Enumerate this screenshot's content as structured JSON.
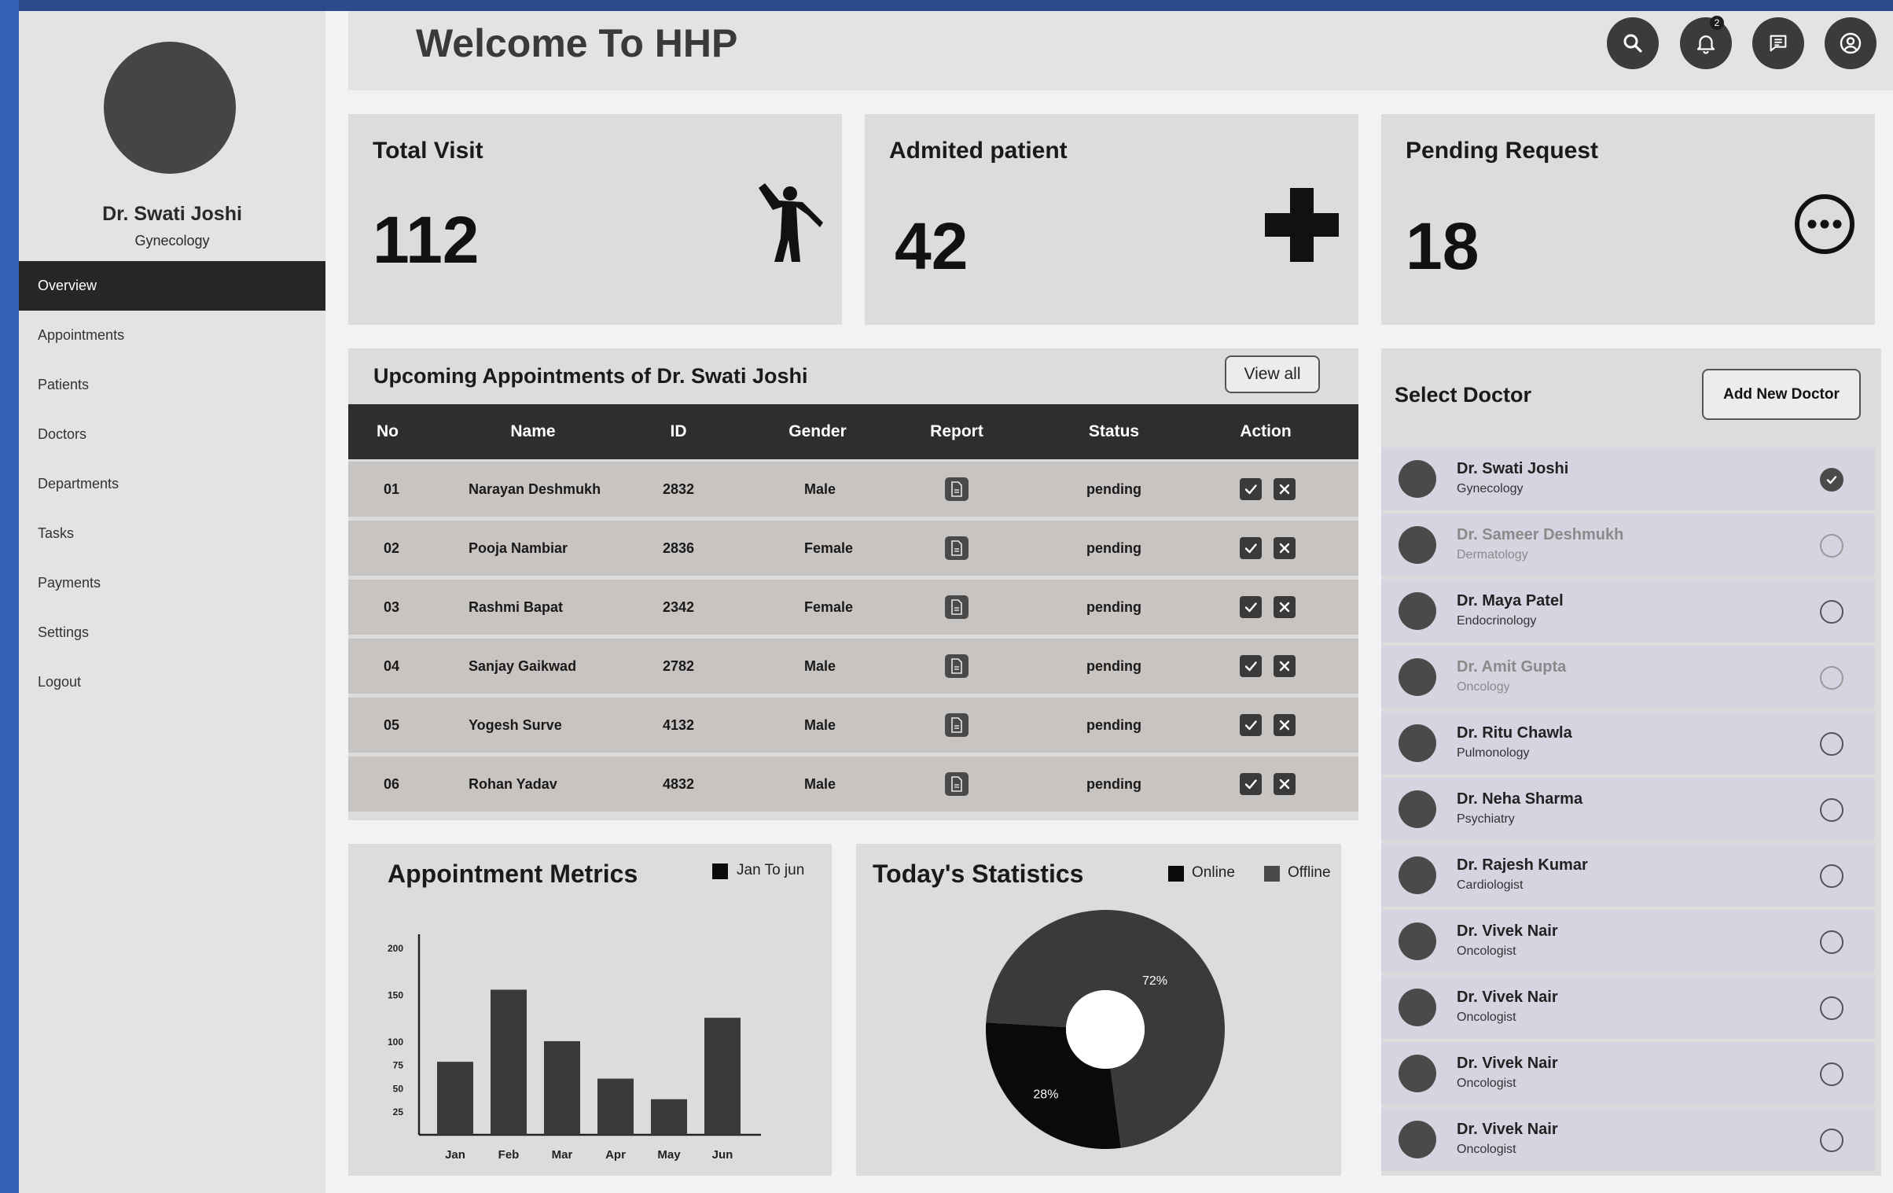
{
  "sidebar": {
    "doctor_name": "Dr. Swati Joshi",
    "doctor_specialty": "Gynecology",
    "items": [
      {
        "label": "Overview"
      },
      {
        "label": "Appointments"
      },
      {
        "label": "Patients"
      },
      {
        "label": "Doctors"
      },
      {
        "label": "Departments"
      },
      {
        "label": "Tasks"
      },
      {
        "label": "Payments"
      },
      {
        "label": "Settings"
      },
      {
        "label": "Logout"
      }
    ],
    "active_item": "Overview"
  },
  "header": {
    "title": "Welcome To HHP",
    "notification_count": "2",
    "icons": [
      "search-icon",
      "bell-icon",
      "chat-icon",
      "user-icon"
    ]
  },
  "stats": {
    "total_visit": {
      "title": "Total Visit",
      "value": "112",
      "icon": "walking-person-icon"
    },
    "admitted": {
      "title": "Admited patient",
      "value": "42",
      "icon": "plus-cross-icon"
    },
    "pending": {
      "title": "Pending Request",
      "value": "18",
      "icon": "more-circle-icon"
    }
  },
  "appointments": {
    "title": "Upcoming  Appointments of Dr. Swati Joshi",
    "view_all_label": "View all",
    "columns": [
      "No",
      "Name",
      "ID",
      "Gender",
      "Report",
      "Status",
      "Action"
    ],
    "rows": [
      {
        "no": "01",
        "name": "Narayan Deshmukh",
        "id": "2832",
        "gender": "Male",
        "status": "pending"
      },
      {
        "no": "02",
        "name": "Pooja Nambiar",
        "id": "2836",
        "gender": "Female",
        "status": "pending"
      },
      {
        "no": "03",
        "name": "Rashmi Bapat",
        "id": "2342",
        "gender": "Female",
        "status": "pending"
      },
      {
        "no": "04",
        "name": "Sanjay Gaikwad",
        "id": "2782",
        "gender": "Male",
        "status": "pending"
      },
      {
        "no": "05",
        "name": "Yogesh Surve",
        "id": "4132",
        "gender": "Male",
        "status": "pending"
      },
      {
        "no": "06",
        "name": "Rohan Yadav",
        "id": "4832",
        "gender": "Male",
        "status": "pending"
      }
    ]
  },
  "metrics": {
    "title": "Appointment Metrics",
    "legend": "Jan To jun"
  },
  "today": {
    "title": "Today's Statistics",
    "legend_online": "Online",
    "legend_offline": "Offline"
  },
  "chart_data": [
    {
      "type": "bar",
      "title": "Appointment Metrics",
      "categories": [
        "Jan",
        "Feb",
        "Mar",
        "Apr",
        "May",
        "Jun"
      ],
      "series": [
        {
          "name": "Jan To jun",
          "values": [
            78,
            155,
            100,
            60,
            38,
            125
          ]
        }
      ],
      "yticks": [
        25,
        50,
        75,
        100,
        150,
        200
      ],
      "ylim": [
        0,
        210
      ],
      "grid": false,
      "legend_position": "top-right",
      "colors": [
        "#3a3a3a"
      ]
    },
    {
      "type": "pie",
      "title": "Today's Statistics",
      "donut": true,
      "slices": [
        {
          "label": "Offline",
          "value": 72,
          "text": "72%",
          "color": "#3a3a3a"
        },
        {
          "label": "Online",
          "value": 28,
          "text": "28%",
          "color": "#0a0a0a"
        }
      ],
      "legend_position": "top-right"
    }
  ],
  "doctors": {
    "title": "Select Doctor",
    "add_label": "Add New Doctor",
    "list": [
      {
        "name": "Dr. Swati Joshi",
        "specialty": "Gynecology",
        "selected": true,
        "dim": false
      },
      {
        "name": "Dr. Sameer Deshmukh",
        "specialty": "Dermatology",
        "selected": false,
        "dim": true
      },
      {
        "name": "Dr. Maya Patel",
        "specialty": "Endocrinology",
        "selected": false,
        "dim": false
      },
      {
        "name": "Dr. Amit Gupta",
        "specialty": "Oncology",
        "selected": false,
        "dim": true
      },
      {
        "name": "Dr. Ritu Chawla",
        "specialty": "Pulmonology",
        "selected": false,
        "dim": false
      },
      {
        "name": "Dr. Neha Sharma",
        "specialty": "Psychiatry",
        "selected": false,
        "dim": false
      },
      {
        "name": "Dr. Rajesh Kumar",
        "specialty": "Cardiologist",
        "selected": false,
        "dim": false
      },
      {
        "name": "Dr. Vivek Nair",
        "specialty": "Oncologist",
        "selected": false,
        "dim": false
      },
      {
        "name": "Dr. Vivek Nair",
        "specialty": "Oncologist",
        "selected": false,
        "dim": false
      },
      {
        "name": "Dr. Vivek Nair",
        "specialty": "Oncologist",
        "selected": false,
        "dim": false
      },
      {
        "name": "Dr. Vivek Nair",
        "specialty": "Oncologist",
        "selected": false,
        "dim": false
      }
    ]
  }
}
